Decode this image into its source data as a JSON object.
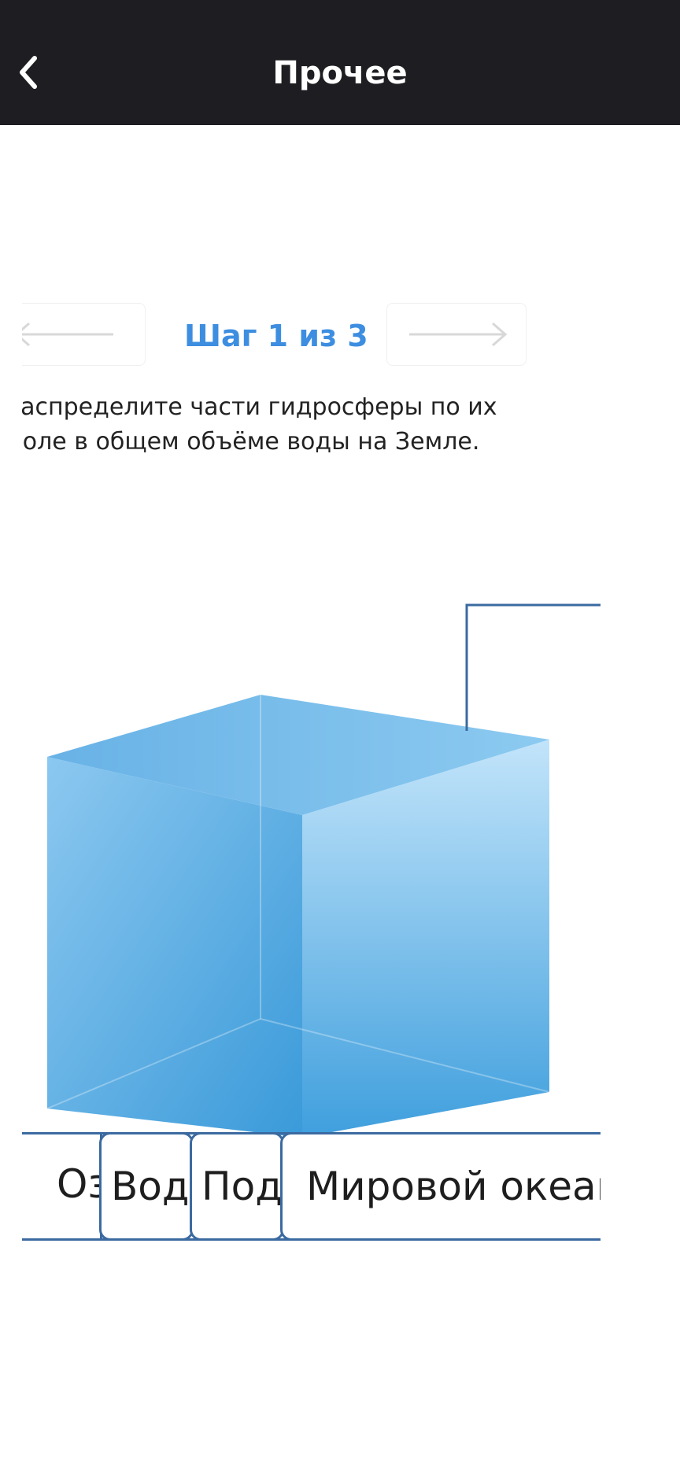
{
  "header": {
    "title": "Прочее",
    "back_icon": "chevron-left-icon"
  },
  "step_nav": {
    "step_label": "Шаг 1 из 3",
    "prev_icon": "arrow-left-icon",
    "next_icon": "arrow-right-icon"
  },
  "instruction": "Распределите части гидросферы по их доле в общем объёме воды на Земле.",
  "options": [
    "Озёра",
    "Водяной пар атмосферы",
    "Подземные воды",
    "Мировой океан"
  ],
  "colors": {
    "header_bg": "#1e1e22",
    "accent": "#3d8ee0",
    "frame": "#3b6aa0",
    "cube_light": "#c2e4fa",
    "cube_dark": "#3a9ad9"
  }
}
